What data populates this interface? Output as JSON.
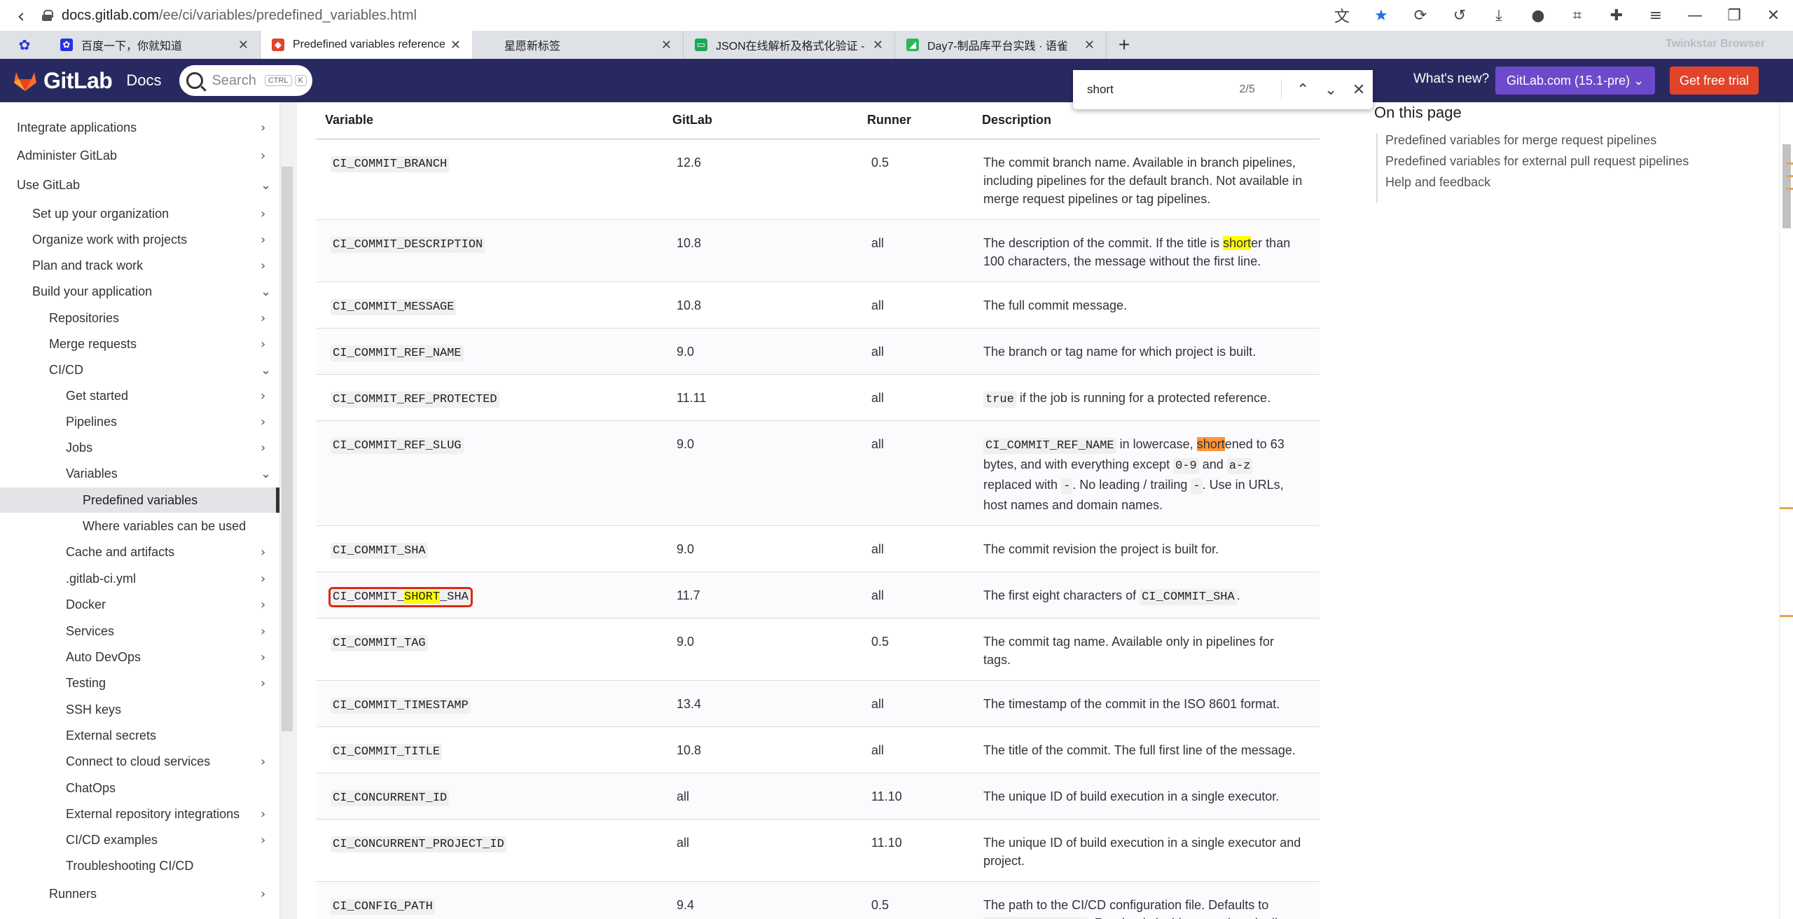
{
  "browser": {
    "url_host": "docs.gitlab.com",
    "url_path": "/ee/ci/variables/predefined_variables.html",
    "brand": "Twinkstar Browser",
    "tabs": [
      {
        "title": "百度一下，你就知道",
        "fav_color": "#2932e1",
        "fav_glyph": "✿"
      },
      {
        "title": "Predefined variables reference",
        "fav_color": "#e24329",
        "fav_glyph": "◆",
        "active": true
      },
      {
        "title": "星愿新标签",
        "fav_color": "#dee1e6",
        "fav_glyph": ""
      },
      {
        "title": "JSON在线解析及格式化验证 - JS",
        "fav_color": "#1aaa55",
        "fav_glyph": "▭"
      },
      {
        "title": "Day7-制品库平台实践 · 语雀",
        "fav_color": "#31b55c",
        "fav_glyph": "◢"
      }
    ]
  },
  "header": {
    "logo_text": "GitLab",
    "docs_label": "Docs",
    "search_placeholder": "Search",
    "kbd_ctrl": "CTRL",
    "kbd_k": "K",
    "whats_new": "What's new?",
    "version": "GitLab.com (15.1-pre) ⌄",
    "trial": "Get free trial"
  },
  "find": {
    "query": "short",
    "count": "2/5"
  },
  "sidebar": {
    "items": [
      {
        "label": "Integrate applications",
        "indent": 0,
        "chev": "›"
      },
      {
        "label": "Administer GitLab",
        "indent": 0,
        "chev": "›"
      },
      {
        "label": "Use GitLab",
        "indent": 0,
        "chev": "⌄"
      },
      {
        "label": "Set up your organization",
        "indent": 1,
        "chev": "›"
      },
      {
        "label": "Organize work with projects",
        "indent": 1,
        "chev": "›"
      },
      {
        "label": "Plan and track work",
        "indent": 1,
        "chev": "›"
      },
      {
        "label": "Build your application",
        "indent": 1,
        "chev": "⌄"
      },
      {
        "label": "Repositories",
        "indent": 2,
        "chev": "›"
      },
      {
        "label": "Merge requests",
        "indent": 2,
        "chev": "›"
      },
      {
        "label": "CI/CD",
        "indent": 2,
        "chev": "⌄"
      },
      {
        "label": "Get started",
        "indent": 3,
        "chev": "›"
      },
      {
        "label": "Pipelines",
        "indent": 3,
        "chev": "›"
      },
      {
        "label": "Jobs",
        "indent": 3,
        "chev": "›"
      },
      {
        "label": "Variables",
        "indent": 3,
        "chev": "⌄"
      },
      {
        "label": "Predefined variables",
        "indent": 4,
        "chev": "",
        "active": true
      },
      {
        "label": "Where variables can be used",
        "indent": 4,
        "chev": ""
      },
      {
        "label": "Cache and artifacts",
        "indent": 3,
        "chev": "›"
      },
      {
        "label": ".gitlab-ci.yml",
        "indent": 3,
        "chev": "›"
      },
      {
        "label": "Docker",
        "indent": 3,
        "chev": "›"
      },
      {
        "label": "Services",
        "indent": 3,
        "chev": "›"
      },
      {
        "label": "Auto DevOps",
        "indent": 3,
        "chev": "›"
      },
      {
        "label": "Testing",
        "indent": 3,
        "chev": "›"
      },
      {
        "label": "SSH keys",
        "indent": 3,
        "chev": ""
      },
      {
        "label": "External secrets",
        "indent": 3,
        "chev": ""
      },
      {
        "label": "Connect to cloud services",
        "indent": 3,
        "chev": "›"
      },
      {
        "label": "ChatOps",
        "indent": 3,
        "chev": ""
      },
      {
        "label": "External repository integrations",
        "indent": 3,
        "chev": "›"
      },
      {
        "label": "CI/CD examples",
        "indent": 3,
        "chev": "›"
      },
      {
        "label": "Troubleshooting CI/CD",
        "indent": 3,
        "chev": ""
      },
      {
        "label": "Runners",
        "indent": 2,
        "chev": "›"
      }
    ]
  },
  "table": {
    "headers": [
      "Variable",
      "GitLab",
      "Runner",
      "Description"
    ],
    "rows": [
      {
        "variable": "CI_COMMIT_BRANCH",
        "gitlab": "12.6",
        "runner": "0.5",
        "desc": "The commit branch name. Available in branch pipelines, including pipelines for the default branch. Not available in merge request pipelines or tag pipelines."
      },
      {
        "variable": "CI_COMMIT_DESCRIPTION",
        "gitlab": "10.8",
        "runner": "all",
        "desc_html": "The description of the commit. If the title is <span class=\"hl\">short</span>er than 100 characters, the message without the first line."
      },
      {
        "variable": "CI_COMMIT_MESSAGE",
        "gitlab": "10.8",
        "runner": "all",
        "desc": "The full commit message."
      },
      {
        "variable": "CI_COMMIT_REF_NAME",
        "gitlab": "9.0",
        "runner": "all",
        "desc": "The branch or tag name for which project is built."
      },
      {
        "variable": "CI_COMMIT_REF_PROTECTED",
        "gitlab": "11.11",
        "runner": "all",
        "desc_html": "<span class=\"code\">true</span> if the job is running for a protected reference."
      },
      {
        "variable": "CI_COMMIT_REF_SLUG",
        "gitlab": "9.0",
        "runner": "all",
        "desc_html": "<span class=\"code\">CI_COMMIT_REF_NAME</span> in lowercase, <span class=\"hlcur\">short</span>ened to 63 bytes, and with everything except <span class=\"code\">0-9</span> and <span class=\"code\">a-z</span> replaced with <span class=\"code\">-</span>. No leading / trailing <span class=\"code\">-</span>. Use in URLs, host names and domain names."
      },
      {
        "variable": "CI_COMMIT_SHA",
        "gitlab": "9.0",
        "runner": "all",
        "desc": "The commit revision the project is built for."
      },
      {
        "variable_html": "CI_COMMIT_<span class=\"hl\">SHORT</span>_SHA",
        "variable": "CI_COMMIT_SHORT_SHA",
        "gitlab": "11.7",
        "runner": "all",
        "desc_html": "The first eight characters of <span class=\"code\">CI_COMMIT_SHA</span>.",
        "boxed": true
      },
      {
        "variable": "CI_COMMIT_TAG",
        "gitlab": "9.0",
        "runner": "0.5",
        "desc": "The commit tag name. Available only in pipelines for tags."
      },
      {
        "variable": "CI_COMMIT_TIMESTAMP",
        "gitlab": "13.4",
        "runner": "all",
        "desc": "The timestamp of the commit in the ISO 8601 format."
      },
      {
        "variable": "CI_COMMIT_TITLE",
        "gitlab": "10.8",
        "runner": "all",
        "desc": "The title of the commit. The full first line of the message."
      },
      {
        "variable": "CI_CONCURRENT_ID",
        "gitlab": "all",
        "runner": "11.10",
        "desc": "The unique ID of build execution in a single executor."
      },
      {
        "variable": "CI_CONCURRENT_PROJECT_ID",
        "gitlab": "all",
        "runner": "11.10",
        "desc": "The unique ID of build execution in a single executor and project."
      },
      {
        "variable": "CI_CONFIG_PATH",
        "gitlab": "9.4",
        "runner": "0.5",
        "desc_html": "The path to the CI/CD configuration file. Defaults to <span class=\"code\">.gitlab-ci.yml</span>. Read-only inside a running pipeline."
      }
    ]
  },
  "toc": {
    "heading": "On this page",
    "links": [
      "Predefined variables for merge request pipelines",
      "Predefined variables for external pull request pipelines",
      "Help and feedback"
    ]
  }
}
